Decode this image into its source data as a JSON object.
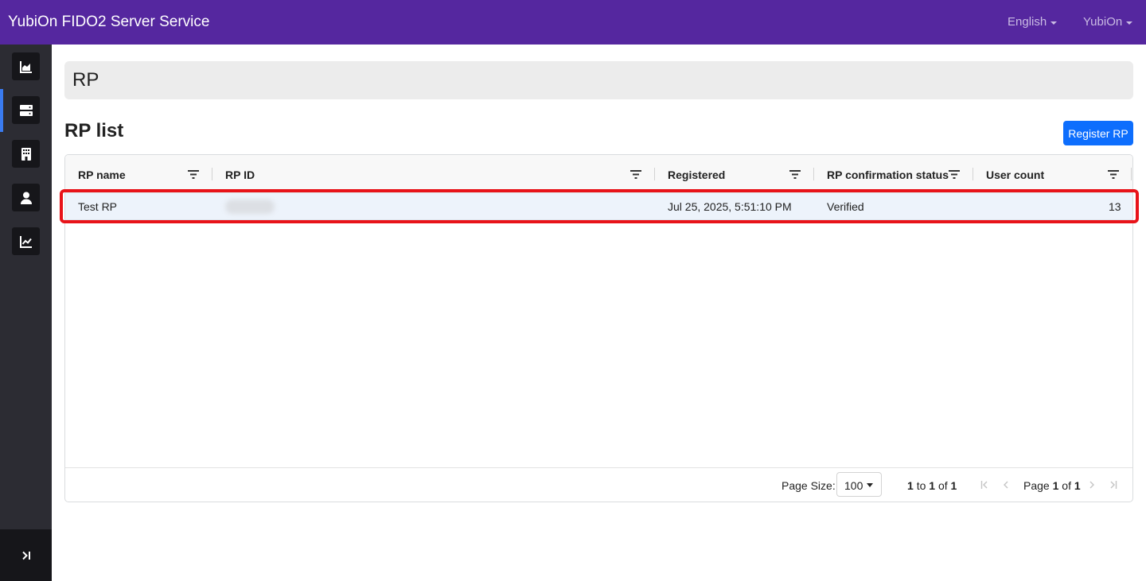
{
  "app": {
    "title": "YubiOn FIDO2 Server Service"
  },
  "nav": {
    "language": "English",
    "account": "YubiOn"
  },
  "sidebar": {
    "items": [
      {
        "icon": "area-chart-icon"
      },
      {
        "icon": "server-icon",
        "active": true
      },
      {
        "icon": "building-icon"
      },
      {
        "icon": "user-icon"
      },
      {
        "icon": "line-chart-icon"
      }
    ],
    "expand_icon": "expand-sidebar-icon"
  },
  "page": {
    "header": "RP",
    "section_title": "RP list",
    "register_button": "Register RP"
  },
  "table": {
    "columns": [
      "RP name",
      "RP ID",
      "Registered",
      "RP confirmation status",
      "User count"
    ],
    "rows": [
      {
        "rp_name": "Test RP",
        "rp_id": "",
        "registered": "Jul 25, 2025, 5:51:10 PM",
        "status": "Verified",
        "user_count": "13"
      }
    ]
  },
  "pagination": {
    "page_size_label": "Page Size:",
    "page_size": "100",
    "from": "1",
    "to_word": "to",
    "to": "1",
    "of_word": "of",
    "total": "1",
    "page_word": "Page",
    "page": "1",
    "page_of_word": "of",
    "page_total": "1"
  },
  "colors": {
    "topbar": "#55279f",
    "sidebar": "#2c2c33",
    "primary": "#0d6efd",
    "highlight": "#e81319",
    "active_indicator": "#3a7bf0"
  }
}
